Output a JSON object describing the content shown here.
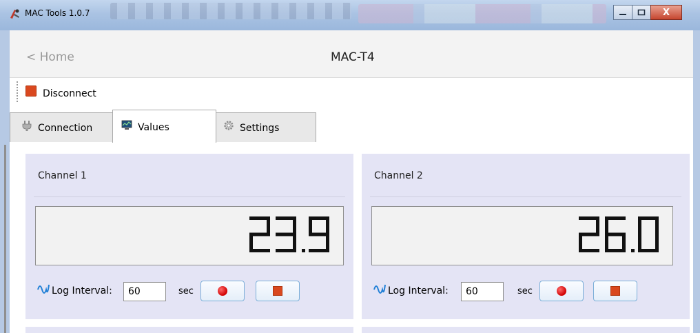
{
  "window": {
    "title": "MAC Tools 1.0.7",
    "close_symbol": "X"
  },
  "nav": {
    "back_label": "< Home",
    "page_title": "MAC-T4"
  },
  "toolbar": {
    "disconnect_label": "Disconnect",
    "disconnect_icon": "stop-square-icon",
    "disconnect_color": "#d9481f"
  },
  "tabs": [
    {
      "label": "Connection",
      "icon": "plug-icon",
      "active": false
    },
    {
      "label": "Values",
      "icon": "monitor-chart-icon",
      "active": true
    },
    {
      "label": "Settings",
      "icon": "gear-icon",
      "active": false
    }
  ],
  "channels": [
    {
      "name": "Channel 1",
      "value": "23.9",
      "log_interval_label": "Log Interval:",
      "log_interval_value": "60",
      "unit": "sec"
    },
    {
      "name": "Channel 2",
      "value": "26.0",
      "log_interval_label": "Log Interval:",
      "log_interval_value": "60",
      "unit": "sec"
    }
  ],
  "colors": {
    "panel_bg": "#e4e4f5",
    "record": "#e00000",
    "stop": "#d9481f",
    "accent_wave": "#1f7fd6"
  }
}
